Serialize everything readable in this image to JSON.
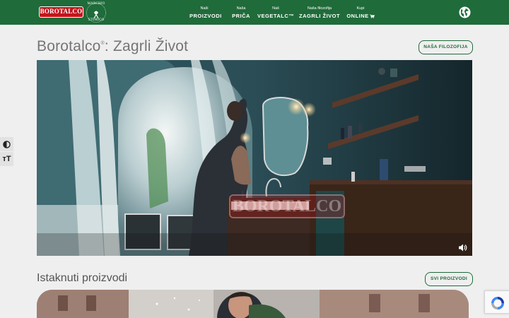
{
  "header": {
    "logo_text": "BOROTALCO",
    "seal_top": "MARCHIO",
    "seal_bottom": "STORICO",
    "nav": [
      {
        "small": "Naši",
        "label": "PROIZVODI"
      },
      {
        "small": "Naša",
        "label": "PRIČA"
      },
      {
        "small": "Naš",
        "label": "VEGETALC™"
      },
      {
        "small": "Naša filozofija",
        "label": "ZAGRLI ŽIVOT"
      },
      {
        "small": "Kupi",
        "label": "ONLINE"
      }
    ],
    "cart_icon": "cart-icon",
    "globe_icon": "globe-icon"
  },
  "hero": {
    "title_brand": "Borotalco",
    "title_mark": "®",
    "title_rest": ": Zagrli Život",
    "button": "NAŠA FILOZOFIJA",
    "video_watermark": "BOROTALCO",
    "volume_icon": "volume-icon"
  },
  "accessibility": {
    "contrast_icon": "contrast-icon",
    "font_size_icon_glyph": "тT"
  },
  "featured": {
    "title": "Istaknuti proizvodi",
    "button": "SVI PROIZVODI"
  },
  "colors": {
    "brand_green": "#1f6b3a",
    "brand_red": "#c4161c",
    "page_bg": "#efefef"
  }
}
